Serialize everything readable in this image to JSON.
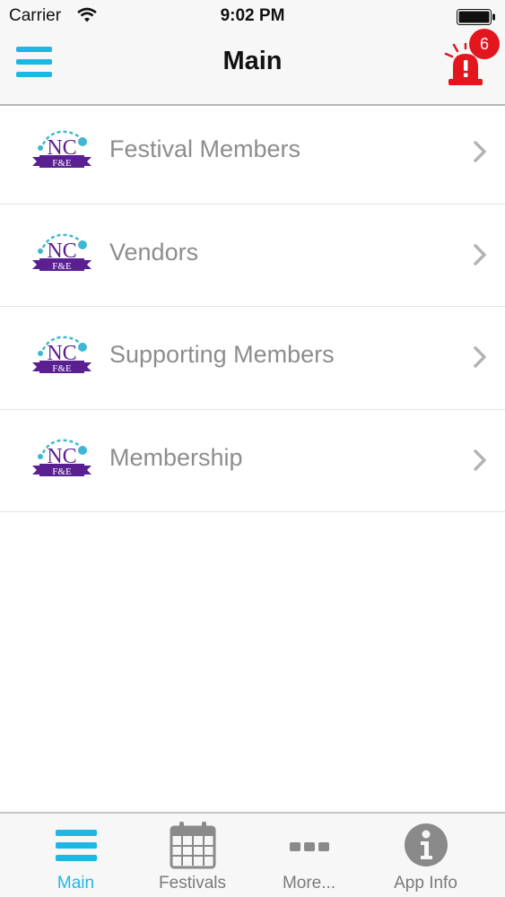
{
  "status_bar": {
    "carrier": "Carrier",
    "time": "9:02 PM"
  },
  "nav": {
    "title": "Main",
    "menu_icon": "hamburger-icon",
    "alert_icon": "siren-icon",
    "alert_badge": "6"
  },
  "logo": {
    "top": "NC",
    "bottom": "F&E"
  },
  "menu_items": [
    {
      "label": "Festival Members"
    },
    {
      "label": "Vendors"
    },
    {
      "label": "Supporting Members"
    },
    {
      "label": "Membership"
    }
  ],
  "tabs": [
    {
      "label": "Main",
      "icon": "hamburger-icon",
      "active": true
    },
    {
      "label": "Festivals",
      "icon": "calendar-icon",
      "active": false
    },
    {
      "label": "More...",
      "icon": "more-dots-icon",
      "active": false
    },
    {
      "label": "App Info",
      "icon": "info-icon",
      "active": false
    }
  ],
  "colors": {
    "accent": "#1fb6e6",
    "alert": "#e3161e",
    "logo_purple": "#5a1f91",
    "text_gray": "#8d8d8d"
  }
}
